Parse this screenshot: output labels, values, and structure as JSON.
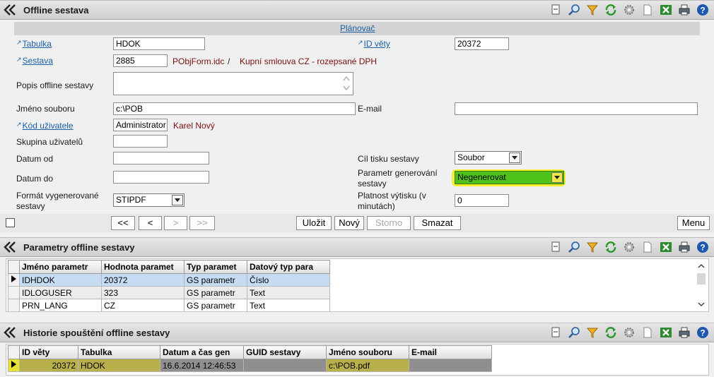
{
  "form_panel": {
    "title": "Offline sestava",
    "scheduler_link": "Plánovač",
    "fields": {
      "tabulka": {
        "label": "Tabulka",
        "value": "HDOK"
      },
      "id_vety": {
        "label": "ID věty",
        "value": "20372"
      },
      "sestava": {
        "label": "Sestava",
        "value": "2885",
        "file": "PObjForm.idc",
        "separator": "/",
        "desc": "Kupní smlouva CZ - rozepsané DPH"
      },
      "popis": {
        "label": "Popis offline sestavy",
        "value": ""
      },
      "jmeno_souboru": {
        "label": "Jméno souboru",
        "value": "c:\\POB"
      },
      "email": {
        "label": "E-mail",
        "value": ""
      },
      "kod_uzivatele": {
        "label": "Kód uživatele",
        "value": "Administrator",
        "name": "Karel Nový"
      },
      "skupina": {
        "label": "Skupina uživatelů",
        "value": ""
      },
      "datum_od": {
        "label": "Datum od",
        "value": ""
      },
      "datum_do": {
        "label": "Datum do",
        "value": ""
      },
      "cil_tisku": {
        "label": "Cíl tisku sestavy",
        "value": "Soubor"
      },
      "parametr_gen": {
        "label_line1": "Parametr generování",
        "label_line2": "sestavy",
        "value": "Negenerovat"
      },
      "format": {
        "label_line1": "Formát vygenerované",
        "label_line2": "sestavy",
        "value": "STIPDF"
      },
      "platnost": {
        "label_line1": "Platnost výtisku (v",
        "label_line2": "minutách)",
        "value": "0"
      }
    },
    "nav_buttons": [
      "<<",
      "<",
      ">",
      ">>"
    ],
    "actions": {
      "save": "Uložit",
      "new": "Nový",
      "cancel": "Storno",
      "delete": "Smazat",
      "menu": "Menu"
    }
  },
  "params_panel": {
    "title": "Parametry offline sestavy",
    "columns": [
      "Jméno parametr",
      "Hodnota paramet",
      "Typ paramet",
      "Datový typ para"
    ],
    "rows": [
      [
        "IDHDOK",
        "20372",
        "GS parametr",
        "Číslo"
      ],
      [
        "IDLOGUSER",
        "323",
        "GS parametr",
        "Text"
      ],
      [
        "PRN_LANG",
        "CZ",
        "GS parametr",
        "Text"
      ]
    ]
  },
  "history_panel": {
    "title": "Historie spouštění offline sestavy",
    "columns": [
      "ID věty",
      "Tabulka",
      "Datum a čas gen",
      "GUID sestavy",
      "Jméno souboru",
      "E-mail"
    ],
    "rows": [
      [
        "20372",
        "HDOK",
        "16.6.2014 12:46:53",
        "",
        "c:\\POB.pdf",
        ""
      ]
    ]
  },
  "toolbar_icons": [
    "new-icon",
    "search-icon",
    "filter-icon",
    "refresh-icon",
    "settings-icon",
    "document-icon",
    "excel-icon",
    "print-icon",
    "help-icon"
  ],
  "colors": {
    "highlight": "#f7ef2a",
    "select_green": "#4ec21a",
    "link": "#1a5fa8",
    "dark_red": "#7a0f0f"
  }
}
